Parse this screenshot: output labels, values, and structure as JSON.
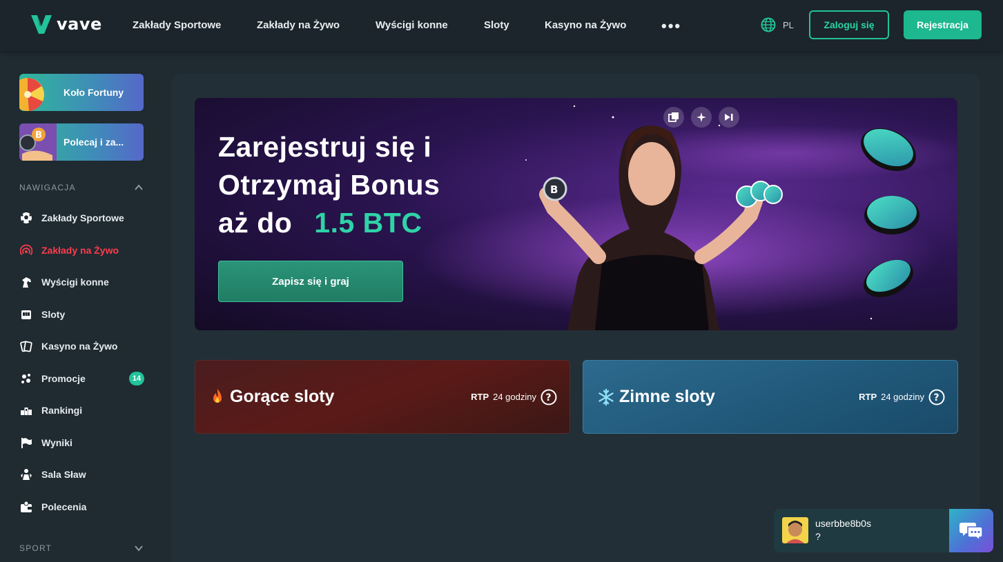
{
  "header": {
    "logo_text": "vave",
    "nav": [
      {
        "label": "Zakłady Sportowe"
      },
      {
        "label": "Zakłady na Żywo"
      },
      {
        "label": "Wyścigi konne"
      },
      {
        "label": "Sloty"
      },
      {
        "label": "Kasyno na Żywo"
      }
    ],
    "more_label": "•••",
    "language": "PL",
    "login_label": "Zaloguj się",
    "register_label": "Rejestracja"
  },
  "sidebar": {
    "promos": [
      {
        "label": "Koło Fortuny",
        "icon": "fortune-wheel-icon"
      },
      {
        "label": "Polecaj i za...",
        "icon": "refer-bitcoin-icon"
      }
    ],
    "nav_heading": "NAWIGACJA",
    "items": [
      {
        "label": "Zakłady Sportowe",
        "icon": "soccer-ball-icon"
      },
      {
        "label": "Zakłady na Żywo",
        "icon": "live-signal-icon",
        "active": true
      },
      {
        "label": "Wyścigi konne",
        "icon": "horse-icon"
      },
      {
        "label": "Sloty",
        "icon": "slot-machine-icon"
      },
      {
        "label": "Kasyno na Żywo",
        "icon": "playing-cards-icon"
      },
      {
        "label": "Promocje",
        "icon": "promo-icon",
        "badge": "14"
      },
      {
        "label": "Rankingi",
        "icon": "ranking-icon"
      },
      {
        "label": "Wyniki",
        "icon": "flag-icon"
      },
      {
        "label": "Sala Sław",
        "icon": "hall-of-fame-icon"
      },
      {
        "label": "Polecenia",
        "icon": "wallet-icon"
      }
    ],
    "sport_heading": "SPORT"
  },
  "hero": {
    "line1": "Zarejestruj się i",
    "line2": "Otrzymaj Bonus",
    "line3_prefix": "aż do",
    "line3_highlight": "1.5 BTC",
    "cta_label": "Zapisz się i graj"
  },
  "slots": {
    "hot": {
      "title": "Gorące sloty",
      "rtp_label": "RTP",
      "rtp_period": "24 godziny"
    },
    "cold": {
      "title": "Zimne sloty",
      "rtp_label": "RTP",
      "rtp_period": "24 godziny"
    }
  },
  "chat": {
    "username": "userbbe8b0s",
    "message": "?"
  },
  "colors": {
    "accent": "#1db88f",
    "active_nav": "#ff3c4b",
    "background": "#1f2a31"
  }
}
